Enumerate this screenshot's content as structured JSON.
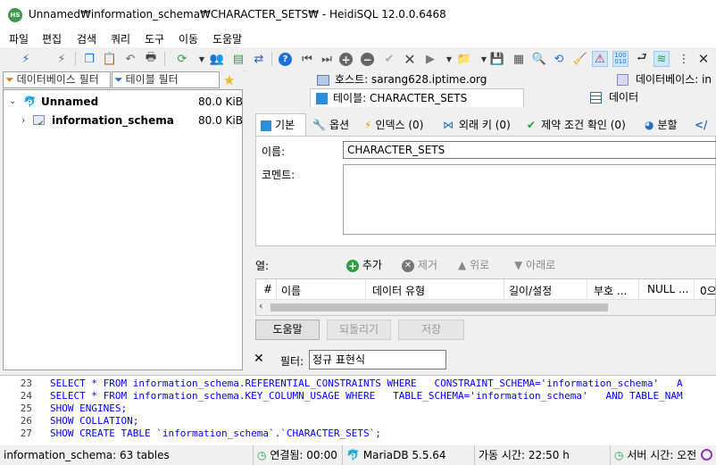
{
  "window": {
    "title": "Unnamed₩information_schema₩CHARACTER_SETS₩ - HeidiSQL 12.0.0.6468",
    "app_icon_text": "HS"
  },
  "menu": [
    "파일",
    "편집",
    "검색",
    "쿼리",
    "도구",
    "이동",
    "도움말"
  ],
  "toolbar_icons": [
    "connect-icon",
    "disconnect-icon",
    "copy-icon",
    "paste-icon",
    "undo-icon",
    "print-icon",
    "refresh-icon",
    "dropdown-icon",
    "users-icon",
    "export-icon",
    "transfer-icon",
    "help-icon",
    "first-icon",
    "last-icon",
    "add-icon",
    "remove-icon",
    "check-icon",
    "cancel-icon",
    "run-icon",
    "open-folder-icon",
    "save-icon",
    "save-all-icon",
    "find-icon",
    "replace-icon",
    "clear-icon",
    "warning-icon",
    "binary-icon",
    "wrap-icon",
    "filter-icon",
    "more-icon",
    "close-icon"
  ],
  "filters": {
    "database_filter": "데이터베이스 필터",
    "table_filter": "테이블 필터"
  },
  "tree": [
    {
      "label": "Unnamed",
      "size": "80.0 KiB",
      "expanded": true
    },
    {
      "label": "information_schema",
      "size": "80.0 KiB",
      "expanded": false
    }
  ],
  "host_tabs": {
    "host": "호스트: sarang628.iptime.org",
    "database": "데이터베이스: in"
  },
  "sub_tabs": {
    "table": "테이블: CHARACTER_SETS",
    "data": "데이터"
  },
  "editor_tabs": [
    "기본",
    "옵션",
    "인덱스 (0)",
    "외래 키 (0)",
    "제약 조건 확인 (0)",
    "분할",
    "</"
  ],
  "form": {
    "name_label": "이름:",
    "name_value": "CHARACTER_SETS",
    "comment_label": "코멘트:",
    "comment_value": "",
    "columns_label": "열:"
  },
  "column_actions": {
    "add": "추가",
    "remove": "제거",
    "up": "위로",
    "down": "아래로"
  },
  "grid_headers": [
    "#",
    "이름",
    "데이터 유형",
    "길이/설정",
    "부호 ...",
    "NULL ...",
    "0으"
  ],
  "buttons": {
    "help": "도움말",
    "revert": "되돌리기",
    "save": "저장"
  },
  "filter_bar": {
    "close": "✕",
    "label": "필터:",
    "value": "정규 표현식"
  },
  "sql": [
    {
      "n": "23",
      "text": "SELECT * FROM information_schema.REFERENTIAL_CONSTRAINTS WHERE   CONSTRAINT_SCHEMA='information_schema'   A"
    },
    {
      "n": "24",
      "text": "SELECT * FROM information_schema.KEY_COLUMN_USAGE WHERE   TABLE_SCHEMA='information_schema'   AND TABLE_NAM"
    },
    {
      "n": "25",
      "text": "SHOW ENGINES;"
    },
    {
      "n": "26",
      "text": "SHOW COLLATION;"
    },
    {
      "n": "27",
      "text": "SHOW CREATE TABLE `information_schema`.`CHARACTER_SETS`;"
    }
  ],
  "status": {
    "tables": "information_schema: 63 tables",
    "connected": "연결됨: 00:00",
    "server": "MariaDB 5.5.64",
    "uptime": "가동 시간: 22:50 h",
    "server_time": "서버 시간: 오전"
  },
  "colors": {
    "accent_green": "#2e9e3e",
    "keyword_blue": "#0000ff",
    "selection_blue": "#cce8ff"
  }
}
